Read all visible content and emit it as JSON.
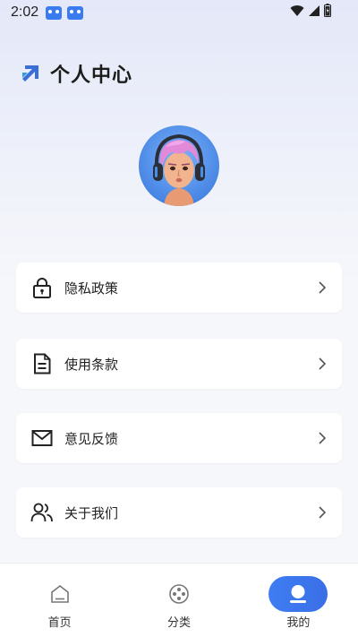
{
  "status_bar": {
    "time": "2:02",
    "notification_icons": [
      "game-controller-icon",
      "game-controller-icon"
    ],
    "system_icons": [
      "wifi-icon",
      "cellular-signal-icon",
      "battery-icon"
    ]
  },
  "header": {
    "title": "个人中心",
    "logo_icon": "arrow-logo-icon"
  },
  "profile": {
    "avatar_icon": "avatar-image"
  },
  "menu": {
    "items": [
      {
        "label": "隐私政策",
        "icon": "lock-icon"
      },
      {
        "label": "使用条款",
        "icon": "document-icon"
      },
      {
        "label": "意见反馈",
        "icon": "mail-icon"
      },
      {
        "label": "关于我们",
        "icon": "users-icon"
      }
    ]
  },
  "bottom_nav": {
    "items": [
      {
        "label": "首页",
        "icon": "home-icon",
        "active": false
      },
      {
        "label": "分类",
        "icon": "category-icon",
        "active": false
      },
      {
        "label": "我的",
        "icon": "profile-icon",
        "active": true
      }
    ]
  },
  "colors": {
    "accent": "#3f7df2",
    "background_top": "#e4e8f8",
    "background_bottom": "#f6f7fb",
    "card": "#ffffff",
    "text": "#222222"
  }
}
